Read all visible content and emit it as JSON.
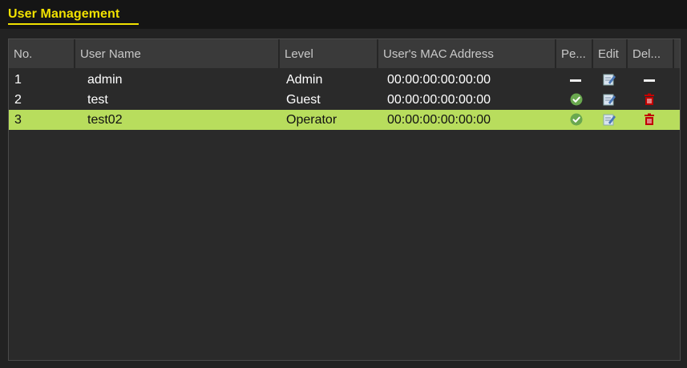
{
  "window": {
    "title": "User Management"
  },
  "table": {
    "headers": [
      "No.",
      "User Name",
      "Level",
      "User's MAC Address",
      "Pe...",
      "Edit",
      "Del..."
    ],
    "rows": [
      {
        "no": "1",
        "user_name": "admin",
        "level": "Admin",
        "mac": "00:00:00:00:00:00",
        "permission": "none",
        "edit": "edit-icon",
        "delete": "none",
        "selected": false
      },
      {
        "no": "2",
        "user_name": "test",
        "level": "Guest",
        "mac": "00:00:00:00:00:00",
        "permission": "check-icon",
        "edit": "edit-icon",
        "delete": "trash-icon",
        "selected": false
      },
      {
        "no": "3",
        "user_name": "test02",
        "level": "Operator",
        "mac": "00:00:00:00:00:00",
        "permission": "check-icon",
        "edit": "edit-icon",
        "delete": "trash-icon",
        "selected": true
      }
    ]
  },
  "colors": {
    "title": "#f2e200",
    "selected_row": "#b8dd5d",
    "check": "#6aa84f",
    "trash": "#c00000"
  }
}
